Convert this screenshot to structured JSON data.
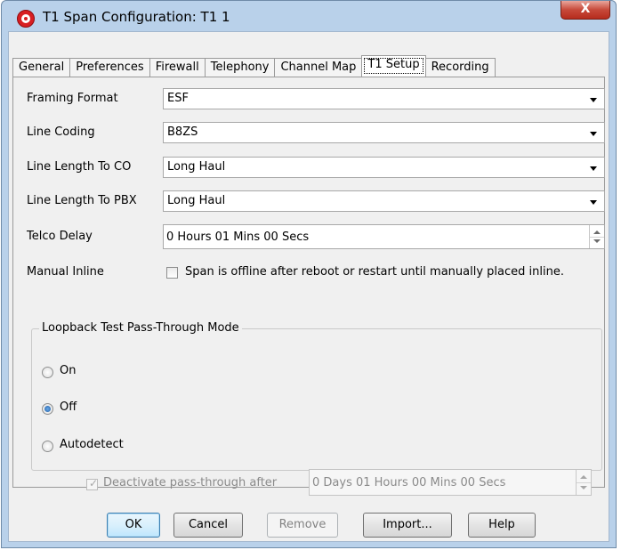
{
  "window": {
    "title": "T1 Span Configuration: T1 1",
    "close_label": "X"
  },
  "tabs": [
    {
      "label": "General",
      "active": false
    },
    {
      "label": "Preferences",
      "active": false
    },
    {
      "label": "Firewall",
      "active": false
    },
    {
      "label": "Telephony",
      "active": false
    },
    {
      "label": "Channel Map",
      "active": false
    },
    {
      "label": "T1 Setup",
      "active": true
    },
    {
      "label": "Recording",
      "active": false
    }
  ],
  "form": {
    "framing_format": {
      "label": "Framing Format",
      "value": "ESF"
    },
    "line_coding": {
      "label": "Line Coding",
      "value": "B8ZS"
    },
    "line_length_co": {
      "label": "Line Length To CO",
      "value": "Long Haul"
    },
    "line_length_pbx": {
      "label": "Line Length To PBX",
      "value": "Long Haul"
    },
    "telco_delay": {
      "label": "Telco Delay",
      "value": "0 Hours 01 Mins 00 Secs"
    },
    "manual_inline": {
      "label": "Manual Inline",
      "checkbox_label": "Span is offline after reboot or restart until manually placed inline.",
      "checked": false
    }
  },
  "loopback": {
    "group_title": "Loopback Test Pass-Through Mode",
    "options": [
      {
        "label": "On",
        "selected": false
      },
      {
        "label": "Off",
        "selected": true
      },
      {
        "label": "Autodetect",
        "selected": false
      }
    ],
    "deactivate": {
      "label": "Deactivate pass-through after",
      "checked": true,
      "enabled": false,
      "value": "0 Days 01 Hours 00 Mins 00 Secs"
    }
  },
  "buttons": {
    "ok": "OK",
    "cancel": "Cancel",
    "remove": "Remove",
    "import": "Import...",
    "help": "Help"
  },
  "colors": {
    "window_frame": "#b9d1ea",
    "close_button": "#c7493a",
    "default_button": "#3c7fb1",
    "dialog_bg": "#f0f0f0"
  }
}
